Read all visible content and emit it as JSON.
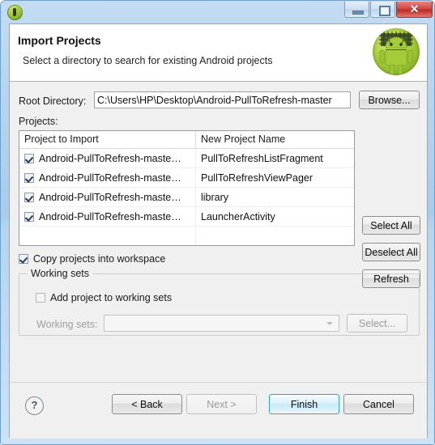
{
  "window": {
    "title": "",
    "icon": "eclipse-icon",
    "controls": {
      "minimize": "minimize-icon",
      "maximize": "restore-icon",
      "close": "✕"
    }
  },
  "header": {
    "title": "Import Projects",
    "description": "Select a directory to search for existing Android projects",
    "icon": "android-robot-icon"
  },
  "form": {
    "root_directory_label": "Root Directory:",
    "root_directory_value": "C:\\Users\\HP\\Desktop\\Android-PullToRefresh-master",
    "root_directory_placeholder": "",
    "browse_label": "Browse..."
  },
  "projects": {
    "label": "Projects:",
    "columns": [
      "Project to Import",
      "New Project Name"
    ],
    "rows": [
      {
        "checked": true,
        "project": "Android-PullToRefresh-maste…",
        "name": "PullToRefreshListFragment"
      },
      {
        "checked": true,
        "project": "Android-PullToRefresh-maste…",
        "name": "PullToRefreshViewPager"
      },
      {
        "checked": true,
        "project": "Android-PullToRefresh-maste…",
        "name": "library"
      },
      {
        "checked": true,
        "project": "Android-PullToRefresh-maste…",
        "name": "LauncherActivity"
      }
    ],
    "side_buttons": [
      {
        "label": "Select All",
        "name": "select-all-button",
        "disabled": false
      },
      {
        "label": "Deselect All",
        "name": "deselect-all-button",
        "disabled": false
      },
      {
        "label": "Refresh",
        "name": "refresh-button",
        "disabled": false
      }
    ]
  },
  "options": {
    "copy_projects_label": "Copy projects into workspace",
    "copy_projects_checked": true
  },
  "working_sets": {
    "group_title": "Working sets",
    "add_label": "Add project to working sets",
    "add_checked": false,
    "combo_label": "Working sets:",
    "combo_value": "",
    "select_label": "Select..."
  },
  "footer": {
    "help": "?",
    "buttons": [
      {
        "label": "< Back",
        "name": "back-button",
        "state": "normal"
      },
      {
        "label": "Next >",
        "name": "next-button",
        "state": "disabled"
      },
      {
        "label": "Finish",
        "name": "finish-button",
        "state": "default"
      },
      {
        "label": "Cancel",
        "name": "cancel-button",
        "state": "normal"
      }
    ]
  },
  "colors": {
    "titlebar": "#b6d4ee",
    "close_button": "#cf4b42",
    "default_button_border": "#2f9bd4",
    "android_green": "#a4cc39",
    "body": "#f0f0f0"
  }
}
